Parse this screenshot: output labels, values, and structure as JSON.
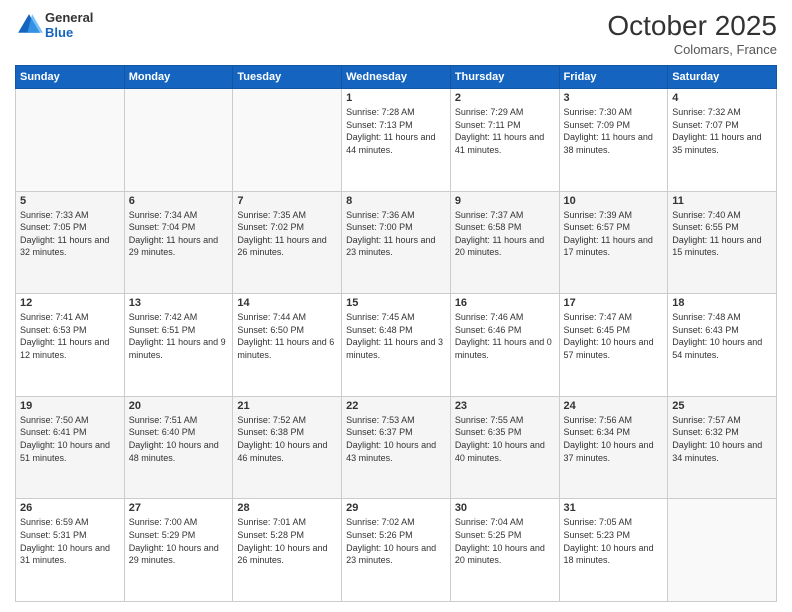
{
  "header": {
    "logo_line1": "General",
    "logo_line2": "Blue",
    "month": "October 2025",
    "location": "Colomars, France"
  },
  "days_of_week": [
    "Sunday",
    "Monday",
    "Tuesday",
    "Wednesday",
    "Thursday",
    "Friday",
    "Saturday"
  ],
  "weeks": [
    [
      {
        "day": "",
        "sunrise": "",
        "sunset": "",
        "daylight": ""
      },
      {
        "day": "",
        "sunrise": "",
        "sunset": "",
        "daylight": ""
      },
      {
        "day": "",
        "sunrise": "",
        "sunset": "",
        "daylight": ""
      },
      {
        "day": "1",
        "sunrise": "Sunrise: 7:28 AM",
        "sunset": "Sunset: 7:13 PM",
        "daylight": "Daylight: 11 hours and 44 minutes."
      },
      {
        "day": "2",
        "sunrise": "Sunrise: 7:29 AM",
        "sunset": "Sunset: 7:11 PM",
        "daylight": "Daylight: 11 hours and 41 minutes."
      },
      {
        "day": "3",
        "sunrise": "Sunrise: 7:30 AM",
        "sunset": "Sunset: 7:09 PM",
        "daylight": "Daylight: 11 hours and 38 minutes."
      },
      {
        "day": "4",
        "sunrise": "Sunrise: 7:32 AM",
        "sunset": "Sunset: 7:07 PM",
        "daylight": "Daylight: 11 hours and 35 minutes."
      }
    ],
    [
      {
        "day": "5",
        "sunrise": "Sunrise: 7:33 AM",
        "sunset": "Sunset: 7:05 PM",
        "daylight": "Daylight: 11 hours and 32 minutes."
      },
      {
        "day": "6",
        "sunrise": "Sunrise: 7:34 AM",
        "sunset": "Sunset: 7:04 PM",
        "daylight": "Daylight: 11 hours and 29 minutes."
      },
      {
        "day": "7",
        "sunrise": "Sunrise: 7:35 AM",
        "sunset": "Sunset: 7:02 PM",
        "daylight": "Daylight: 11 hours and 26 minutes."
      },
      {
        "day": "8",
        "sunrise": "Sunrise: 7:36 AM",
        "sunset": "Sunset: 7:00 PM",
        "daylight": "Daylight: 11 hours and 23 minutes."
      },
      {
        "day": "9",
        "sunrise": "Sunrise: 7:37 AM",
        "sunset": "Sunset: 6:58 PM",
        "daylight": "Daylight: 11 hours and 20 minutes."
      },
      {
        "day": "10",
        "sunrise": "Sunrise: 7:39 AM",
        "sunset": "Sunset: 6:57 PM",
        "daylight": "Daylight: 11 hours and 17 minutes."
      },
      {
        "day": "11",
        "sunrise": "Sunrise: 7:40 AM",
        "sunset": "Sunset: 6:55 PM",
        "daylight": "Daylight: 11 hours and 15 minutes."
      }
    ],
    [
      {
        "day": "12",
        "sunrise": "Sunrise: 7:41 AM",
        "sunset": "Sunset: 6:53 PM",
        "daylight": "Daylight: 11 hours and 12 minutes."
      },
      {
        "day": "13",
        "sunrise": "Sunrise: 7:42 AM",
        "sunset": "Sunset: 6:51 PM",
        "daylight": "Daylight: 11 hours and 9 minutes."
      },
      {
        "day": "14",
        "sunrise": "Sunrise: 7:44 AM",
        "sunset": "Sunset: 6:50 PM",
        "daylight": "Daylight: 11 hours and 6 minutes."
      },
      {
        "day": "15",
        "sunrise": "Sunrise: 7:45 AM",
        "sunset": "Sunset: 6:48 PM",
        "daylight": "Daylight: 11 hours and 3 minutes."
      },
      {
        "day": "16",
        "sunrise": "Sunrise: 7:46 AM",
        "sunset": "Sunset: 6:46 PM",
        "daylight": "Daylight: 11 hours and 0 minutes."
      },
      {
        "day": "17",
        "sunrise": "Sunrise: 7:47 AM",
        "sunset": "Sunset: 6:45 PM",
        "daylight": "Daylight: 10 hours and 57 minutes."
      },
      {
        "day": "18",
        "sunrise": "Sunrise: 7:48 AM",
        "sunset": "Sunset: 6:43 PM",
        "daylight": "Daylight: 10 hours and 54 minutes."
      }
    ],
    [
      {
        "day": "19",
        "sunrise": "Sunrise: 7:50 AM",
        "sunset": "Sunset: 6:41 PM",
        "daylight": "Daylight: 10 hours and 51 minutes."
      },
      {
        "day": "20",
        "sunrise": "Sunrise: 7:51 AM",
        "sunset": "Sunset: 6:40 PM",
        "daylight": "Daylight: 10 hours and 48 minutes."
      },
      {
        "day": "21",
        "sunrise": "Sunrise: 7:52 AM",
        "sunset": "Sunset: 6:38 PM",
        "daylight": "Daylight: 10 hours and 46 minutes."
      },
      {
        "day": "22",
        "sunrise": "Sunrise: 7:53 AM",
        "sunset": "Sunset: 6:37 PM",
        "daylight": "Daylight: 10 hours and 43 minutes."
      },
      {
        "day": "23",
        "sunrise": "Sunrise: 7:55 AM",
        "sunset": "Sunset: 6:35 PM",
        "daylight": "Daylight: 10 hours and 40 minutes."
      },
      {
        "day": "24",
        "sunrise": "Sunrise: 7:56 AM",
        "sunset": "Sunset: 6:34 PM",
        "daylight": "Daylight: 10 hours and 37 minutes."
      },
      {
        "day": "25",
        "sunrise": "Sunrise: 7:57 AM",
        "sunset": "Sunset: 6:32 PM",
        "daylight": "Daylight: 10 hours and 34 minutes."
      }
    ],
    [
      {
        "day": "26",
        "sunrise": "Sunrise: 6:59 AM",
        "sunset": "Sunset: 5:31 PM",
        "daylight": "Daylight: 10 hours and 31 minutes."
      },
      {
        "day": "27",
        "sunrise": "Sunrise: 7:00 AM",
        "sunset": "Sunset: 5:29 PM",
        "daylight": "Daylight: 10 hours and 29 minutes."
      },
      {
        "day": "28",
        "sunrise": "Sunrise: 7:01 AM",
        "sunset": "Sunset: 5:28 PM",
        "daylight": "Daylight: 10 hours and 26 minutes."
      },
      {
        "day": "29",
        "sunrise": "Sunrise: 7:02 AM",
        "sunset": "Sunset: 5:26 PM",
        "daylight": "Daylight: 10 hours and 23 minutes."
      },
      {
        "day": "30",
        "sunrise": "Sunrise: 7:04 AM",
        "sunset": "Sunset: 5:25 PM",
        "daylight": "Daylight: 10 hours and 20 minutes."
      },
      {
        "day": "31",
        "sunrise": "Sunrise: 7:05 AM",
        "sunset": "Sunset: 5:23 PM",
        "daylight": "Daylight: 10 hours and 18 minutes."
      },
      {
        "day": "",
        "sunrise": "",
        "sunset": "",
        "daylight": ""
      }
    ]
  ]
}
